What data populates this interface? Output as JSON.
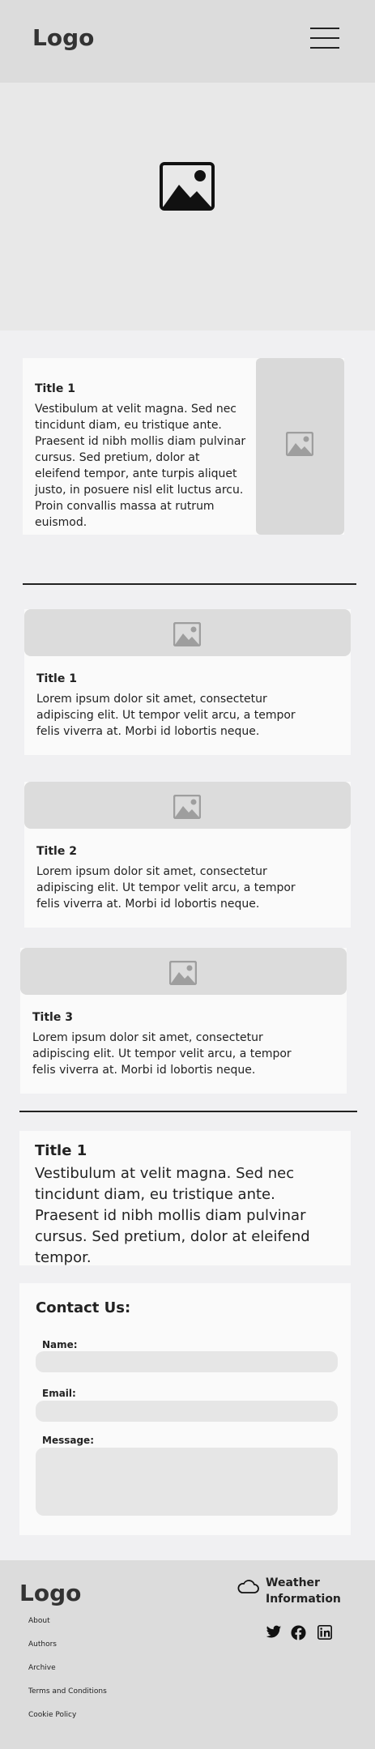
{
  "header": {
    "logo": "Logo",
    "menu_icon": "hamburger-icon"
  },
  "hero": {
    "icon": "image-placeholder-icon"
  },
  "feature_card": {
    "title": "Title 1",
    "text": "Vestibulum at velit magna. Sed nec tincidunt diam, eu tristique ante. Praesent id nibh mollis diam pulvinar cursus. Sed pretium, dolor at eleifend tempor, ante turpis aliquet justo, in posuere nisl elit luctus arcu. Proin convallis massa at rutrum euismod."
  },
  "cards": [
    {
      "title": "Title 1",
      "text": "Lorem ipsum dolor sit amet, consectetur adipiscing elit. Ut tempor velit arcu, a tempor felis viverra at. Morbi id lobortis neque."
    },
    {
      "title": "Title 2",
      "text": "Lorem ipsum dolor sit amet, consectetur adipiscing elit. Ut tempor velit arcu, a tempor felis viverra at. Morbi id lobortis neque."
    },
    {
      "title": "Title 3",
      "text": "Lorem ipsum dolor sit amet, consectetur adipiscing elit. Ut tempor velit arcu, a tempor felis viverra at. Morbi id lobortis neque."
    }
  ],
  "text_block": {
    "title": "Title 1",
    "text": "Vestibulum at velit magna. Sed nec tincidunt diam, eu tristique ante. Praesent id nibh mollis diam pulvinar cursus. Sed pretium, dolor at eleifend tempor."
  },
  "contact": {
    "heading": "Contact Us:",
    "name_label": "Name:",
    "email_label": "Email:",
    "message_label": "Message:"
  },
  "footer": {
    "logo": "Logo",
    "links": [
      "About",
      "Authors",
      "Archive",
      "Terms and Conditions",
      "Cookie Policy"
    ],
    "weather": "Weather Information",
    "social_icons": [
      "twitter-icon",
      "facebook-icon",
      "linkedin-icon"
    ]
  },
  "colors": {
    "header_bg": "#dcdcdc",
    "page_bg": "#f0f0f2",
    "placeholder": "#9e9e9e"
  }
}
